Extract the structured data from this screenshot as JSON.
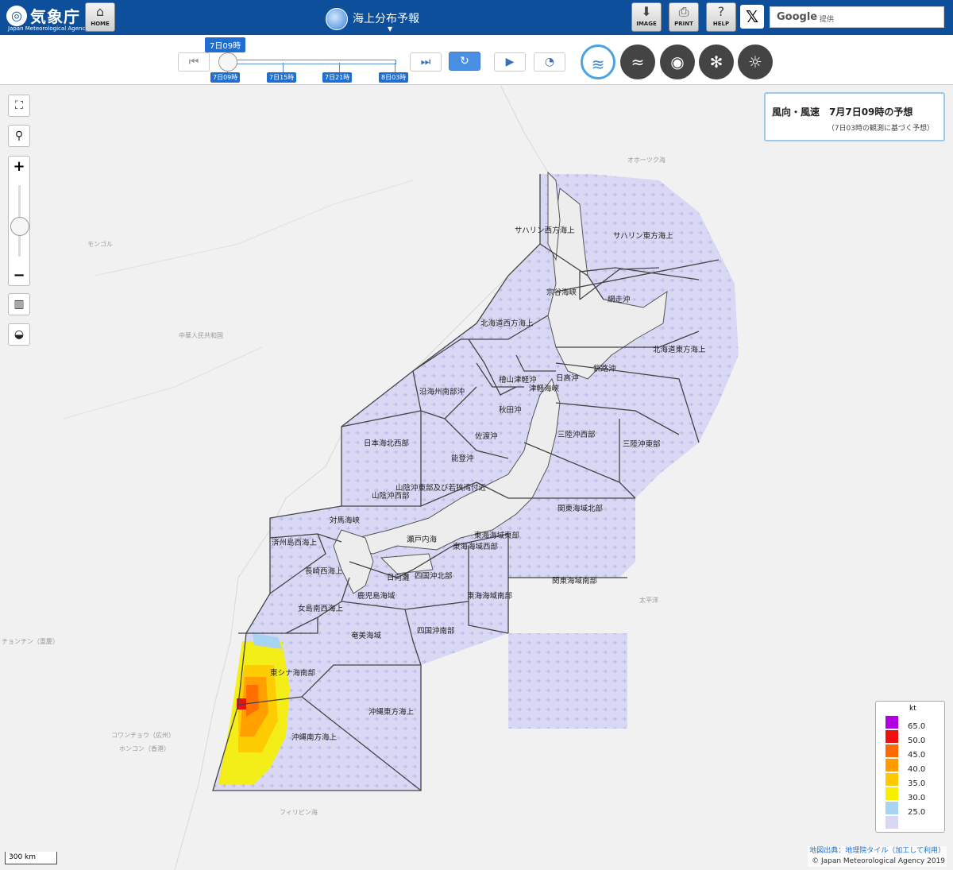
{
  "header": {
    "agency_name": "気象庁",
    "agency_en": "Japan Meteorological Agency",
    "home_label": "HOME",
    "page_title": "海上分布予報",
    "image_label": "IMAGE",
    "print_label": "PRINT",
    "help_label": "HELP",
    "x_label": "𝕏",
    "search_brand": "Google",
    "search_placeholder": "提供"
  },
  "timeline": {
    "current": "7日09時",
    "ticks": [
      "7日09時",
      "7日15時",
      "7日21時",
      "8日03時"
    ],
    "position_fraction": 0
  },
  "elements": {
    "wind": "wind-icon",
    "wave": "wave-icon",
    "visibility": "eye-icon",
    "ice": "snowflake-icon",
    "weather": "weather-icon"
  },
  "info_panel": {
    "title": "風向・風速　7月7日09時の予想",
    "subtitle": "（7日03時の観測に基づく予想）"
  },
  "legend": {
    "unit": "kt",
    "items": [
      {
        "value": "65.0",
        "color": "#b000e0"
      },
      {
        "value": "50.0",
        "color": "#ee1010"
      },
      {
        "value": "45.0",
        "color": "#ff6a00"
      },
      {
        "value": "40.0",
        "color": "#ff9a00"
      },
      {
        "value": "35.0",
        "color": "#ffc800"
      },
      {
        "value": "30.0",
        "color": "#f6f000"
      },
      {
        "value": "25.0",
        "color": "#a8d4f4"
      },
      {
        "value": "",
        "color": "#d8d8f4"
      }
    ]
  },
  "map": {
    "scale": "300 km",
    "attribution_source": "地図出典：地理院タイル（加工して利用）",
    "copyright": "© Japan Meteorological Agency 2019",
    "zoom_level_fraction": 0.55,
    "areas": [
      "サハリン西方海上",
      "サハリン東方海上",
      "宗谷海峡",
      "網走沖",
      "北海道西方海上",
      "北海道東方海上",
      "檜山津軽沖",
      "日高沖",
      "津軽海峡",
      "釧路沖",
      "沿海州南部沖",
      "秋田沖",
      "三陸沖西部",
      "三陸沖東部",
      "日本海北西部",
      "佐渡沖",
      "能登沖",
      "山陰沖東部及び若狭湾付近",
      "山陰沖西部",
      "関東海域北部",
      "対馬海峡",
      "済州島西海上",
      "瀬戸内海",
      "東海海域東部",
      "東海海域西部",
      "長崎西海上",
      "日向灘",
      "四国沖北部",
      "関東海域南部",
      "鹿児島海域",
      "東海海域南部",
      "女島南西海上",
      "奄美海域",
      "四国沖南部",
      "東シナ海南部",
      "沖縄東方海上",
      "沖縄南方海上"
    ],
    "background_labels": [
      "オホーツク海",
      "モンゴル",
      "中華人民共和国",
      "フィリピン海",
      "太平洋",
      "コワンチョウ（広州）",
      "ホンコン（香港）",
      "チョンチン（重慶）"
    ]
  }
}
